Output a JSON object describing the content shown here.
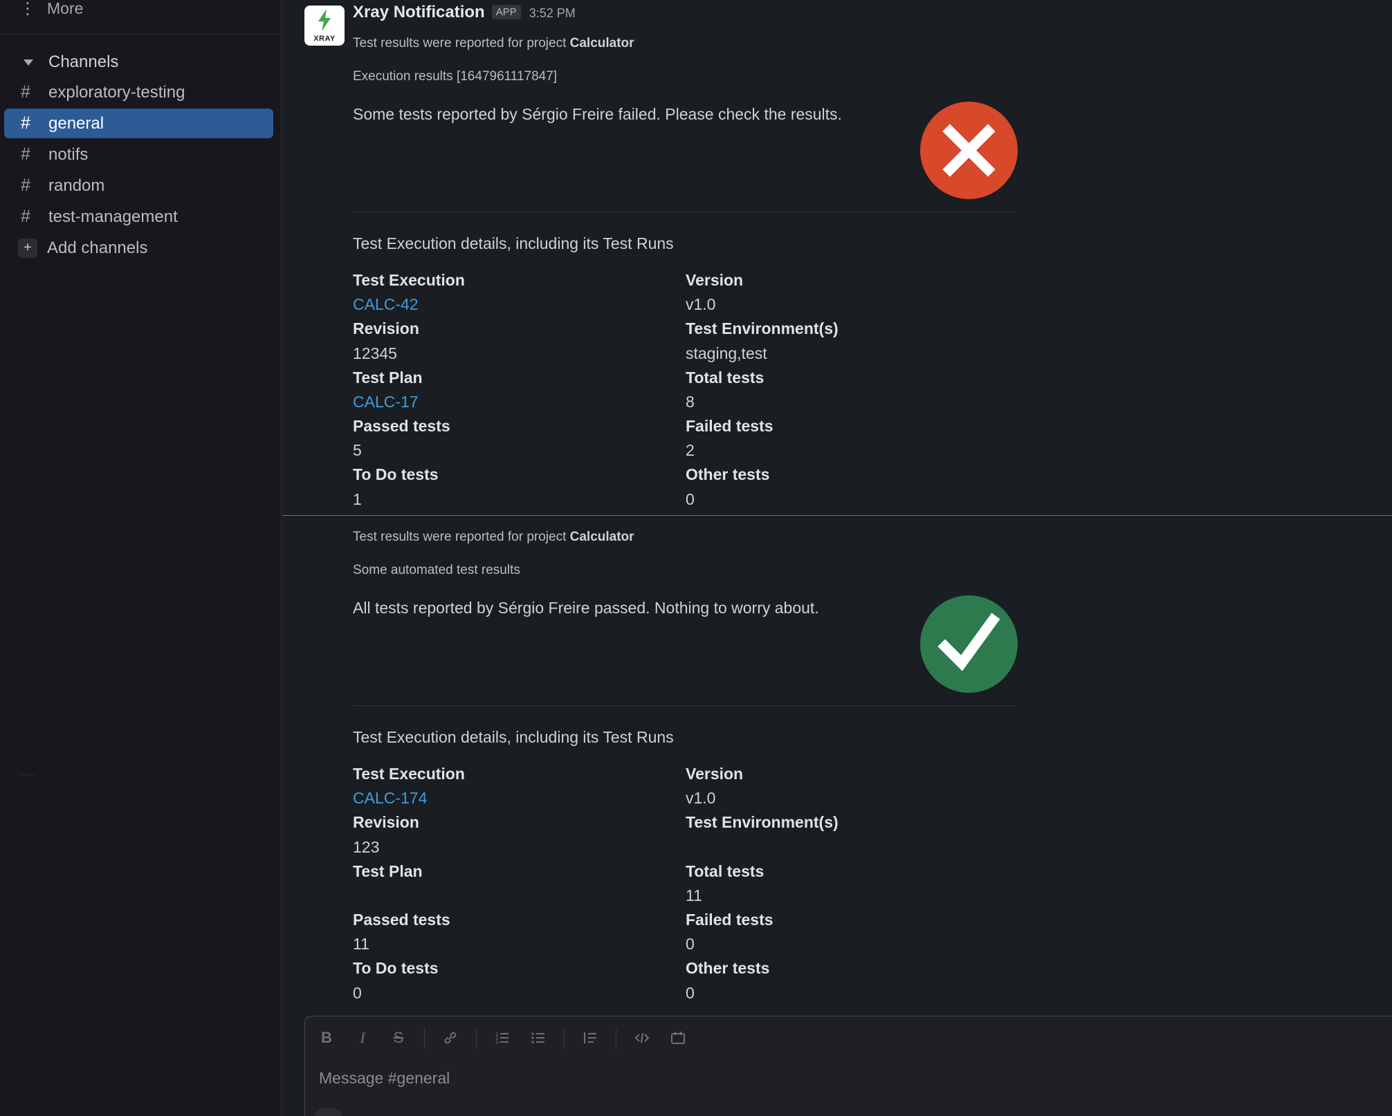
{
  "sidebar": {
    "more_label": "More",
    "section_label": "Channels",
    "channels": [
      {
        "name": "exploratory-testing",
        "active": false
      },
      {
        "name": "general",
        "active": true
      },
      {
        "name": "notifs",
        "active": false
      },
      {
        "name": "random",
        "active": false
      },
      {
        "name": "test-management",
        "active": false
      }
    ],
    "add_channels_label": "Add channels"
  },
  "message": {
    "sender": "Xray Notification",
    "app_badge": "APP",
    "time": "3:52 PM",
    "avatar_text": "XRAY",
    "project_prefix": "Test results were reported for project ",
    "project_name": "Calculator"
  },
  "results": [
    {
      "title": "Execution results [1647961117847]",
      "summary": "Some tests reported by Sérgio Freire failed. Please check the results.",
      "status": "failed",
      "details_heading": "Test Execution details, including its Test Runs",
      "fields": {
        "test_execution_label": "Test Execution",
        "test_execution": "CALC-42",
        "version_label": "Version",
        "version": "v1.0",
        "revision_label": "Revision",
        "revision": "12345",
        "environments_label": "Test Environment(s)",
        "environments": "staging,test",
        "test_plan_label": "Test Plan",
        "test_plan": "CALC-17",
        "total_label": "Total tests",
        "total": "8",
        "passed_label": "Passed tests",
        "passed": "5",
        "failed_label": "Failed tests",
        "failed": "2",
        "todo_label": "To Do tests",
        "todo": "1",
        "other_label": "Other tests",
        "other": "0"
      }
    },
    {
      "title": "Some automated test results",
      "summary": "All tests reported by Sérgio Freire passed. Nothing to worry about.",
      "status": "passed",
      "details_heading": "Test Execution details, including its Test Runs",
      "fields": {
        "test_execution_label": "Test Execution",
        "test_execution": "CALC-174",
        "version_label": "Version",
        "version": "v1.0",
        "revision_label": "Revision",
        "revision": "123",
        "environments_label": "Test Environment(s)",
        "environments": "",
        "test_plan_label": "Test Plan",
        "test_plan": "",
        "total_label": "Total tests",
        "total": "11",
        "passed_label": "Passed tests",
        "passed": "11",
        "failed_label": "Failed tests",
        "failed": "0",
        "todo_label": "To Do tests",
        "todo": "0",
        "other_label": "Other tests",
        "other": "0"
      }
    }
  ],
  "composer": {
    "placeholder": "Message #general",
    "toolbar_icons": [
      "bold-icon",
      "italic-icon",
      "strikethrough-icon",
      "link-icon",
      "ordered-list-icon",
      "bulleted-list-icon",
      "blockquote-icon",
      "code-icon",
      "code-block-icon"
    ]
  },
  "colors": {
    "sidebar_active": "#2c5b96",
    "link": "#3e9de0",
    "fail": "#d8482a",
    "pass": "#2e7a4f",
    "new_divider": "#c7531e"
  }
}
